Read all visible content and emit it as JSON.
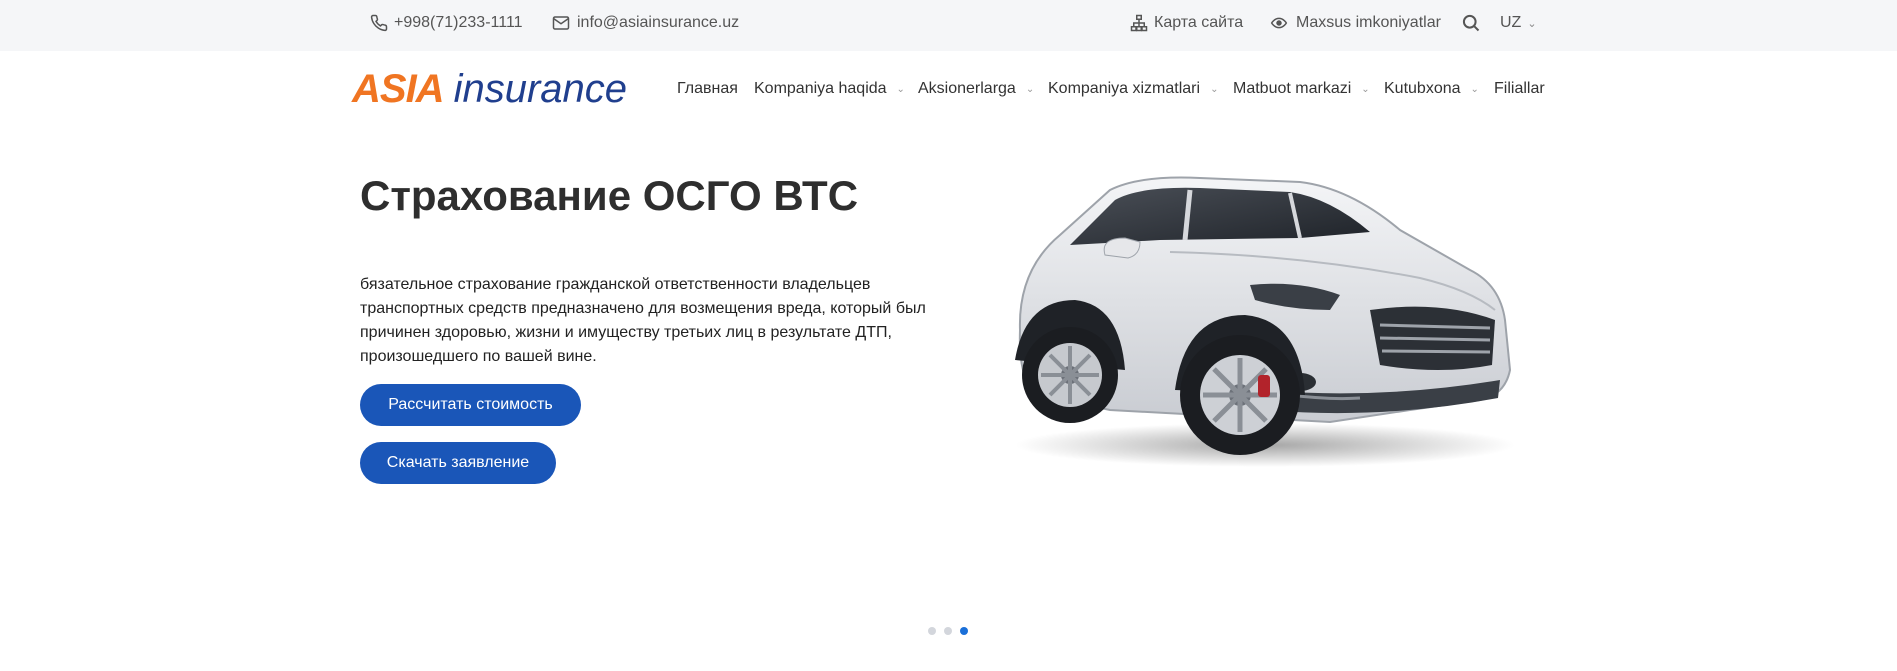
{
  "topbar": {
    "phone": "+998(71)233-1111",
    "email": "info@asiainsurance.uz",
    "sitemap": "Карта сайта",
    "accessibility": "Maxsus imkoniyatlar",
    "language": "UZ"
  },
  "logo": {
    "part1": "ASIA",
    "part2": "insurance"
  },
  "nav": [
    {
      "label": "Главная",
      "dropdown": false
    },
    {
      "label": "Kompaniya haqida",
      "dropdown": true
    },
    {
      "label": "Aksionerlarga",
      "dropdown": true
    },
    {
      "label": "Kompaniya xizmatlari",
      "dropdown": true
    },
    {
      "label": "Matbuot markazi",
      "dropdown": true
    },
    {
      "label": "Kutubxona",
      "dropdown": true
    },
    {
      "label": "Filiallar",
      "dropdown": false
    }
  ],
  "hero": {
    "title": "Страхование ОСГО ВТС",
    "text": "бязательное страхование гражданской ответственности владельцев транспортных средств  предназначено для возмещения вреда, который был причинен здоровью, жизни и имуществу третьих лиц в результате ДТП, произошедшего по вашей вине.",
    "btn_calc": "Рассчитать стоимость",
    "btn_download": "Скачать заявление"
  },
  "slider": {
    "total": 3,
    "active": 3
  },
  "colors": {
    "accent": "#1a56b8",
    "logo_orange": "#f07522",
    "logo_blue": "#203f8e",
    "topbar_bg": "#f5f6f8"
  }
}
